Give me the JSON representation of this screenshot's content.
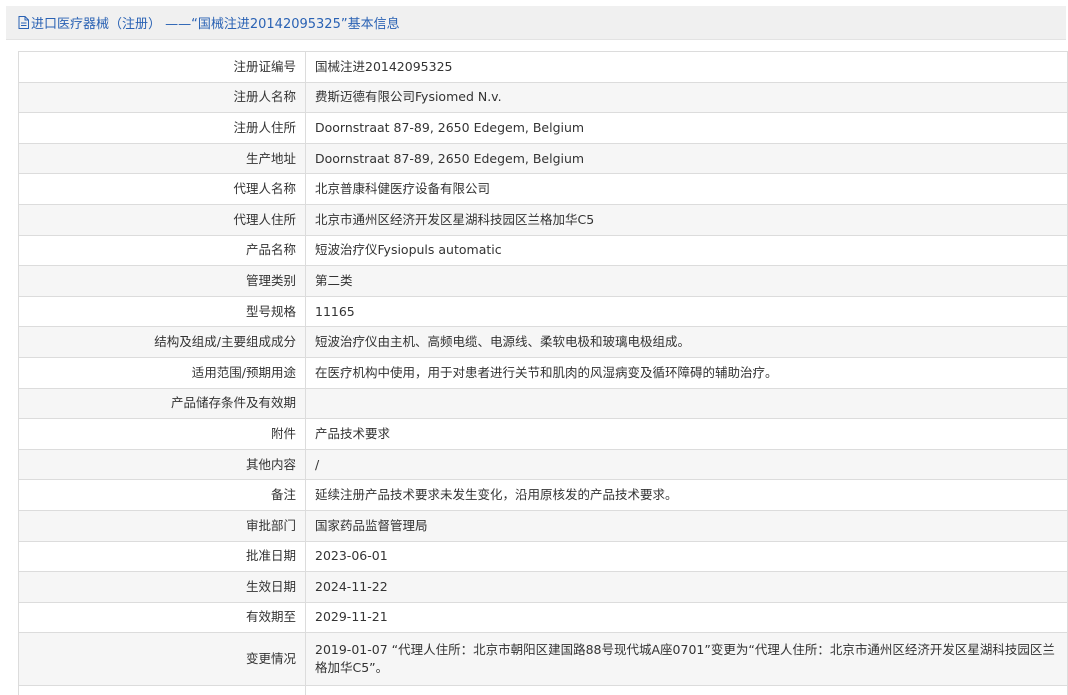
{
  "header": {
    "icon": "document-icon",
    "title": "进口医疗器械（注册） ——“国械注进20142095325”基本信息"
  },
  "rows": [
    {
      "label": "注册证编号",
      "value": "国械注进20142095325"
    },
    {
      "label": "注册人名称",
      "value": "费斯迈德有限公司Fysiomed N.v."
    },
    {
      "label": "注册人住所",
      "value": "Doornstraat 87-89, 2650 Edegem, Belgium"
    },
    {
      "label": "生产地址",
      "value": "Doornstraat 87-89, 2650 Edegem, Belgium"
    },
    {
      "label": "代理人名称",
      "value": "北京普康科健医疗设备有限公司"
    },
    {
      "label": "代理人住所",
      "value": "北京市通州区经济开发区星湖科技园区兰格加华C5"
    },
    {
      "label": "产品名称",
      "value": "短波治疗仪Fysiopuls automatic"
    },
    {
      "label": "管理类别",
      "value": "第二类"
    },
    {
      "label": "型号规格",
      "value": "11165"
    },
    {
      "label": "结构及组成/主要组成成分",
      "value": "短波治疗仪由主机、高频电缆、电源线、柔软电极和玻璃电极组成。"
    },
    {
      "label": "适用范围/预期用途",
      "value": "在医疗机构中使用，用于对患者进行关节和肌肉的风湿病变及循环障碍的辅助治疗。"
    },
    {
      "label": "产品储存条件及有效期",
      "value": ""
    },
    {
      "label": "附件",
      "value": "产品技术要求"
    },
    {
      "label": "其他内容",
      "value": "/"
    },
    {
      "label": "备注",
      "value": "延续注册产品技术要求未发生变化，沿用原核发的产品技术要求。"
    },
    {
      "label": "审批部门",
      "value": "国家药品监督管理局"
    },
    {
      "label": "批准日期",
      "value": "2023-06-01"
    },
    {
      "label": "生效日期",
      "value": "2024-11-22"
    },
    {
      "label": "有效期至",
      "value": "2029-11-21"
    },
    {
      "label": "变更情况",
      "value": "2019-01-07 “代理人住所：北京市朝阳区建国路88号现代城A座0701”变更为“代理人住所：北京市通州区经济开发区星湖科技园区兰格加华C5”。"
    }
  ],
  "colors": {
    "header_text": "#2a62b4",
    "header_bg": "#f0f0f0",
    "border": "#dcdcdc",
    "row_alt": "#f6f6f6"
  }
}
